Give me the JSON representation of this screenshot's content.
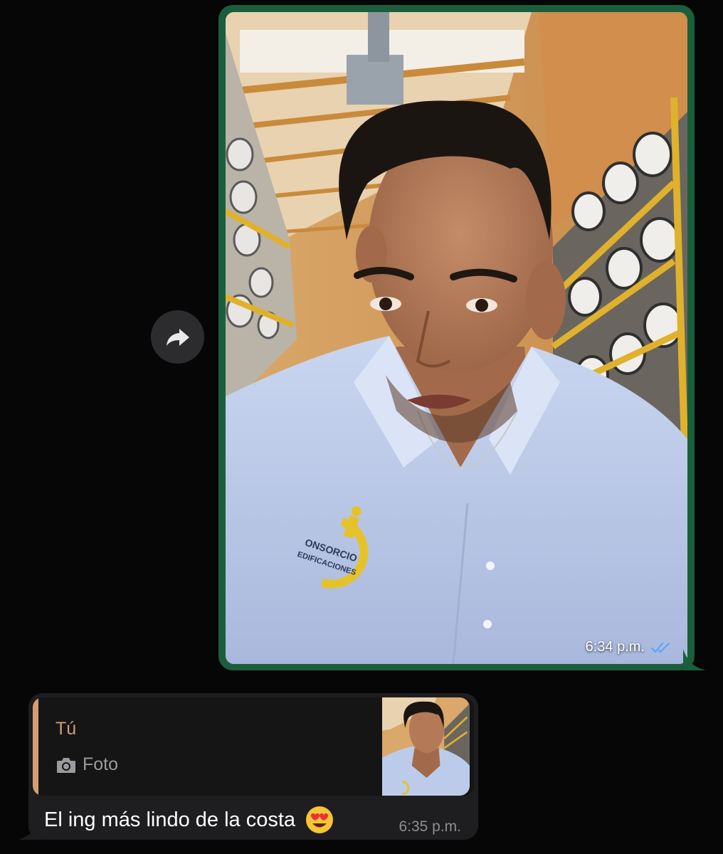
{
  "outgoing_message": {
    "time": "6:34 p.m.",
    "status": "read",
    "status_color": "#5aa6ff",
    "bubble_color": "#1b5e3c"
  },
  "forward_button": {
    "icon": "forward-arrow-icon"
  },
  "reply_message": {
    "quote_author": "Tú",
    "quote_author_color": "#d39e73",
    "quote_type_icon": "camera-icon",
    "quote_type_label": "Foto",
    "text": "El ing más lindo de la costa",
    "emoji": "smiling-face-with-heart-eyes",
    "time": "6:35 p.m."
  },
  "photo": {
    "logo_text": [
      "ONSORCIO",
      "EDIFICACIONES"
    ]
  }
}
